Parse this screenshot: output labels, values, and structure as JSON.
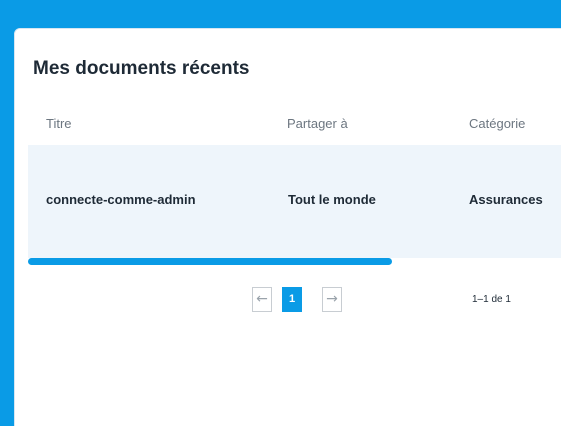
{
  "card": {
    "title": "Mes documents récents"
  },
  "table": {
    "headers": [
      "Titre",
      "Partager à",
      "Catégorie"
    ],
    "rows": [
      [
        "connecte-comme-admin",
        "Tout le monde",
        "Assurances"
      ]
    ]
  },
  "pagination": {
    "prev_icon": "←",
    "next_icon": "→",
    "current_page": "1",
    "info": "1–1 de 1"
  },
  "colors": {
    "accent": "#0a9be6",
    "row_highlight": "#eef5fb"
  }
}
